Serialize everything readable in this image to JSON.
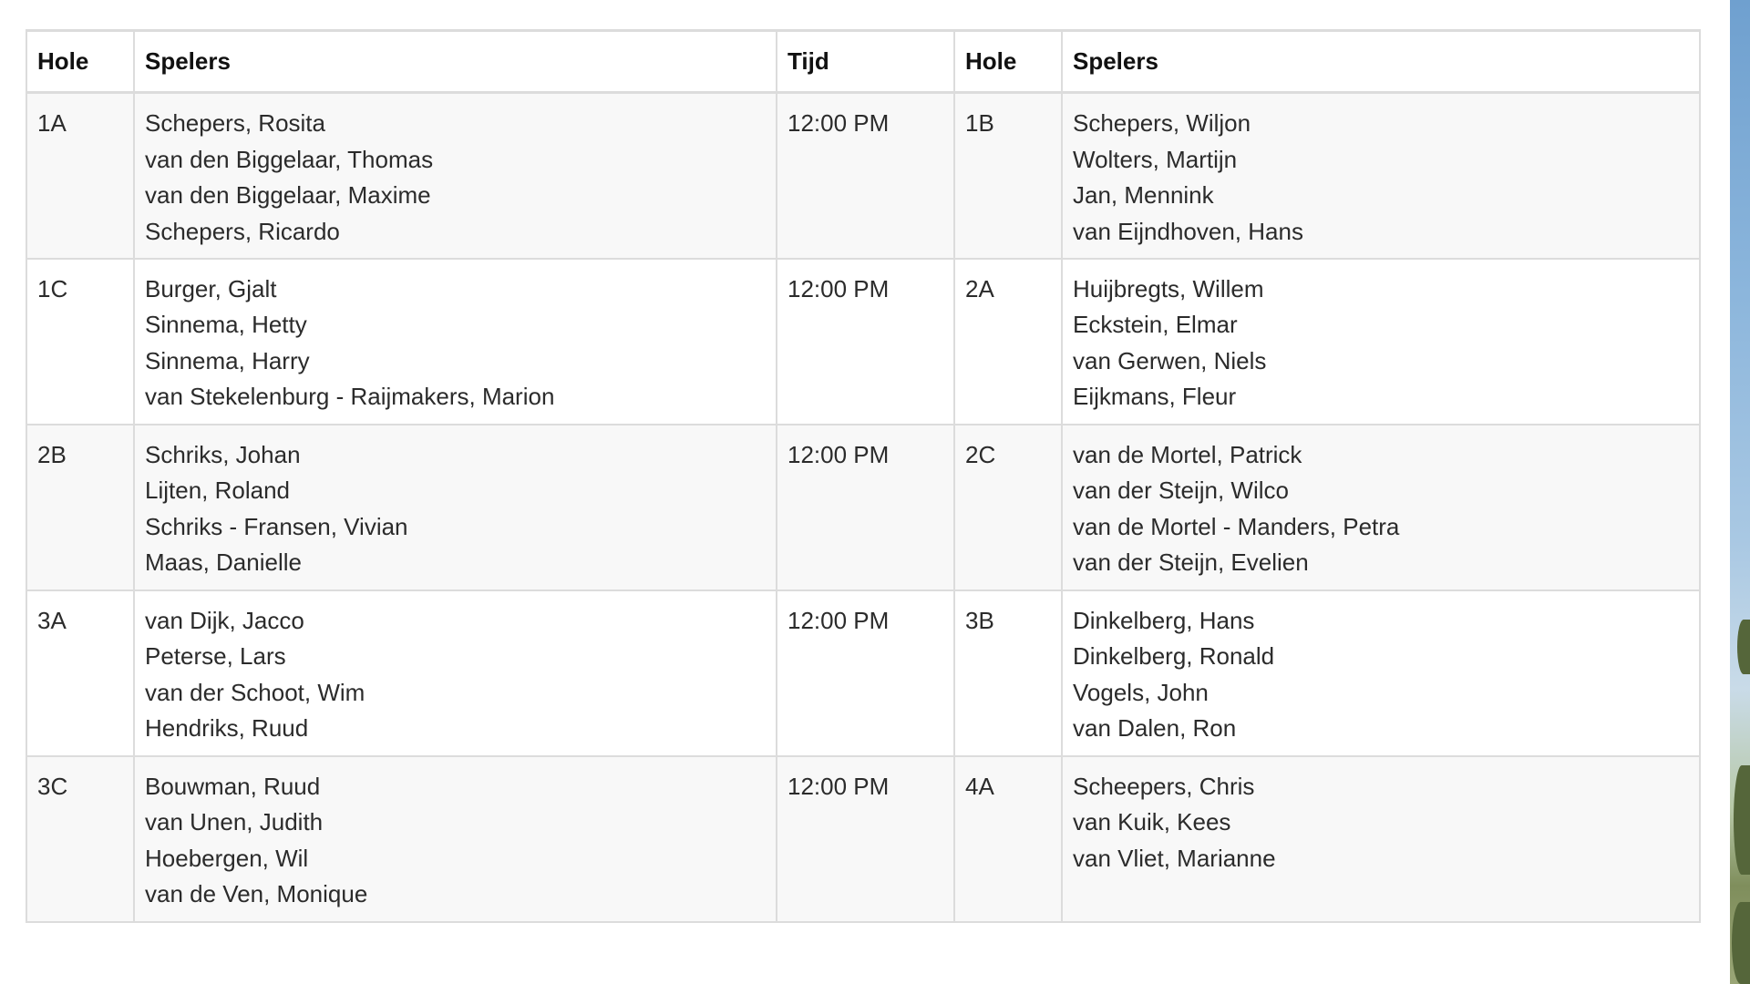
{
  "table": {
    "headers": [
      "Hole",
      "Spelers",
      "Tijd",
      "Hole",
      "Spelers"
    ],
    "rows": [
      {
        "hole_left": "1A",
        "players_left": [
          "Schepers, Rosita",
          "van den Biggelaar, Thomas",
          "van den Biggelaar, Maxime",
          "Schepers, Ricardo"
        ],
        "time": "12:00 PM",
        "hole_right": "1B",
        "players_right": [
          "Schepers, Wiljon",
          "Wolters, Martijn",
          "Jan, Mennink",
          "van Eijndhoven, Hans"
        ]
      },
      {
        "hole_left": "1C",
        "players_left": [
          "Burger, Gjalt",
          "Sinnema, Hetty",
          "Sinnema, Harry",
          "van Stekelenburg - Raijmakers, Marion"
        ],
        "time": "12:00 PM",
        "hole_right": "2A",
        "players_right": [
          "Huijbregts, Willem",
          "Eckstein, Elmar",
          "van Gerwen, Niels",
          "Eijkmans, Fleur"
        ]
      },
      {
        "hole_left": "2B",
        "players_left": [
          "Schriks, Johan",
          "Lijten, Roland",
          "Schriks - Fransen, Vivian",
          "Maas, Danielle"
        ],
        "time": "12:00 PM",
        "hole_right": "2C",
        "players_right": [
          "van de Mortel, Patrick",
          "van der Steijn, Wilco",
          "van de Mortel - Manders, Petra",
          "van der Steijn, Evelien"
        ]
      },
      {
        "hole_left": "3A",
        "players_left": [
          "van Dijk, Jacco",
          "Peterse, Lars",
          "van der Schoot, Wim",
          "Hendriks, Ruud"
        ],
        "time": "12:00 PM",
        "hole_right": "3B",
        "players_right": [
          "Dinkelberg, Hans",
          "Dinkelberg, Ronald",
          "Vogels, John",
          "van Dalen, Ron"
        ]
      },
      {
        "hole_left": "3C",
        "players_left": [
          "Bouwman, Ruud",
          "van Unen, Judith",
          "Hoebergen, Wil",
          "van de Ven, Monique"
        ],
        "time": "12:00 PM",
        "hole_right": "4A",
        "players_right": [
          "Scheepers, Chris",
          "van Kuik, Kees",
          "van Vliet, Marianne"
        ]
      }
    ]
  },
  "colors": {
    "border": "#dcdcdc",
    "row_shade": "#f8f8f8",
    "text": "#2b2b2b",
    "header_text": "#111111"
  }
}
